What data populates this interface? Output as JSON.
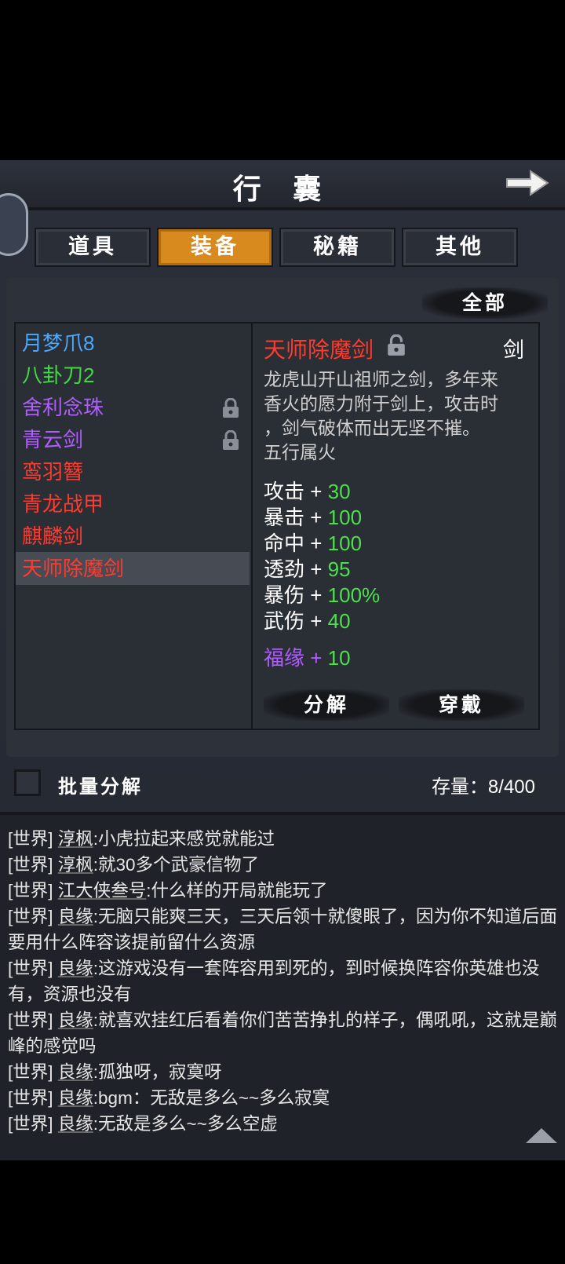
{
  "header": {
    "title": "行 囊"
  },
  "tabs": [
    {
      "label": "道具",
      "active": false
    },
    {
      "label": "装备",
      "active": true
    },
    {
      "label": "秘籍",
      "active": false
    },
    {
      "label": "其他",
      "active": false
    }
  ],
  "filter": {
    "label": "全部"
  },
  "items": [
    {
      "name": "月梦爪8",
      "color": "#4aa8ff",
      "locked": false,
      "selected": false
    },
    {
      "name": "八卦刀2",
      "color": "#42d842",
      "locked": false,
      "selected": false
    },
    {
      "name": "舍利念珠",
      "color": "#b05cff",
      "locked": true,
      "selected": false
    },
    {
      "name": "青云剑",
      "color": "#b05cff",
      "locked": true,
      "selected": false
    },
    {
      "name": "鸾羽簪",
      "color": "#ff3b2f",
      "locked": false,
      "selected": false
    },
    {
      "name": "青龙战甲",
      "color": "#ff3b2f",
      "locked": false,
      "selected": false
    },
    {
      "name": "麒麟剑",
      "color": "#ff3b2f",
      "locked": false,
      "selected": false
    },
    {
      "name": "天师除魔剑",
      "color": "#ff3b2f",
      "locked": false,
      "selected": true
    }
  ],
  "detail": {
    "name": "天师除魔剑",
    "type": "剑",
    "desc_lines": [
      "龙虎山开山祖师之剑，多年来",
      "香火的愿力附于剑上，攻击时",
      "，剑气破体而出无坚不摧。",
      "五行属火"
    ],
    "stats": [
      {
        "name": "攻击",
        "plus": "+",
        "value": "30"
      },
      {
        "name": "暴击",
        "plus": "+",
        "value": "100"
      },
      {
        "name": "命中",
        "plus": "+",
        "value": "100"
      },
      {
        "name": "透劲",
        "plus": "+",
        "value": "95"
      },
      {
        "name": "暴伤",
        "plus": "+",
        "value": "100%"
      },
      {
        "name": "武伤",
        "plus": "+",
        "value": "40"
      }
    ],
    "fortune": {
      "name": "福缘",
      "plus": "+",
      "value": "10"
    },
    "disassemble_label": "分解",
    "equip_label": "穿戴"
  },
  "batch": {
    "label": "批量分解",
    "storage": "存量：8/400"
  },
  "chat": [
    {
      "channel": "[世界]",
      "user": "淳枫",
      "text": ":小虎拉起来感觉就能过"
    },
    {
      "channel": "[世界]",
      "user": "淳枫",
      "text": ":就30多个武豪信物了"
    },
    {
      "channel": "[世界]",
      "user": "江大侠叁号",
      "text": ":什么样的开局就能玩了"
    },
    {
      "channel": "[世界]",
      "user": "良缘",
      "text": ":无脑只能爽三天，三天后领十就傻眼了，因为你不知道后面要用什么阵容该提前留什么资源"
    },
    {
      "channel": "[世界]",
      "user": "良缘",
      "text": ":这游戏没有一套阵容用到死的，到时候换阵容你英雄也没有，资源也没有"
    },
    {
      "channel": "[世界]",
      "user": "良缘",
      "text": ":就喜欢挂红后看着你们苦苦挣扎的样子，偶吼吼，这就是巅峰的感觉吗"
    },
    {
      "channel": "[世界]",
      "user": "良缘",
      "text": ":孤独呀，寂寞呀"
    },
    {
      "channel": "[世界]",
      "user": "良缘",
      "text": ":bgm：无敌是多么~~多么寂寞"
    },
    {
      "channel": "[世界]",
      "user": "良缘",
      "text": ":无敌是多么~~多么空虚"
    }
  ],
  "colors": {
    "accent": "#d88a1f",
    "stat_value": "#4de04d",
    "purple": "#b05cff",
    "red": "#ff3b2f"
  }
}
